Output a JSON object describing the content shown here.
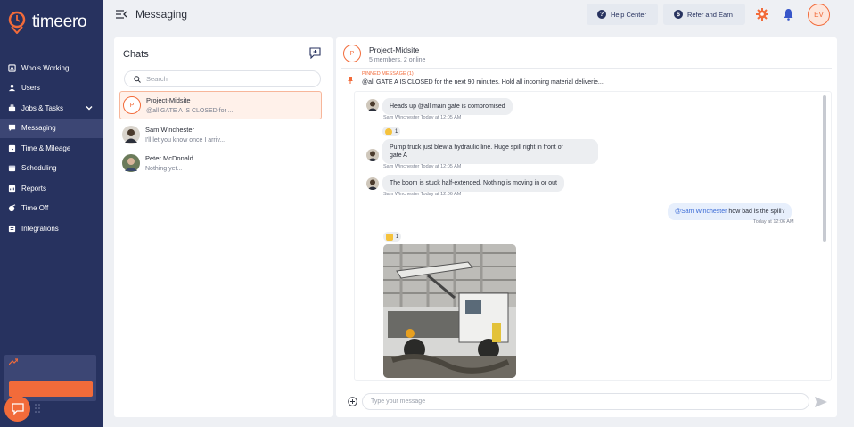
{
  "app": {
    "name": "timeero"
  },
  "colors": {
    "sidebar": "#27325f",
    "accent": "#f26b3a",
    "mention": "#3b6bd6"
  },
  "sidebar": {
    "items": [
      {
        "label": "Who's Working",
        "icon": "map-pin-icon"
      },
      {
        "label": "Users",
        "icon": "users-icon"
      },
      {
        "label": "Jobs & Tasks",
        "icon": "briefcase-icon"
      },
      {
        "label": "Messaging",
        "icon": "chat-icon"
      },
      {
        "label": "Time & Mileage",
        "icon": "clock-icon"
      },
      {
        "label": "Scheduling",
        "icon": "calendar-icon"
      },
      {
        "label": "Reports",
        "icon": "chart-icon"
      },
      {
        "label": "Time Off",
        "icon": "time-off-icon"
      },
      {
        "label": "Integrations",
        "icon": "integrations-icon"
      }
    ],
    "active_item": "Messaging"
  },
  "header": {
    "title": "Messaging",
    "help_label": "Help Center",
    "refer_label": "Refer and Earn",
    "user_initials": "EV"
  },
  "chats": {
    "title": "Chats",
    "search_placeholder": "Search",
    "items": [
      {
        "name": "Project-Midsite",
        "preview": "@all GATE A IS CLOSED for ...",
        "avatar_letter": "P",
        "active": true
      },
      {
        "name": "Sam Winchester",
        "preview": "I'll let you know once I arriv...",
        "avatar_letter": ""
      },
      {
        "name": "Peter McDonald",
        "preview": "Nothing yet...",
        "avatar_letter": ""
      }
    ]
  },
  "conversation": {
    "avatar_letter": "P",
    "name": "Project-Midsite",
    "subtitle": "5 members, 2 online",
    "pinned_label": "PINNED MESSAGE (1)",
    "pinned_text": "@all GATE A IS CLOSED for the next 90 minutes. Hold all incoming material deliverie...",
    "messages": [
      {
        "text": "Heads up @all main gate is compromised",
        "meta": "Sam Winchester Today at 12:05 AM"
      },
      {
        "reaction_count": "1"
      },
      {
        "text_line1": "Pump truck just blew a hydraulic line. Huge spill right in front of",
        "text_line2": "gate A",
        "meta": "Sam Winchester Today at 12:05 AM"
      },
      {
        "text": "The boom is stuck half-extended. Nothing is moving in or out",
        "meta": "Sam Winchester Today at 12:06 AM"
      },
      {
        "mention": "@Sam Winchester",
        "text": " how bad is the spill?",
        "meta": "Today at 12:06 AM"
      },
      {
        "reaction_count": "1"
      }
    ],
    "composer_placeholder": "Type your message"
  }
}
